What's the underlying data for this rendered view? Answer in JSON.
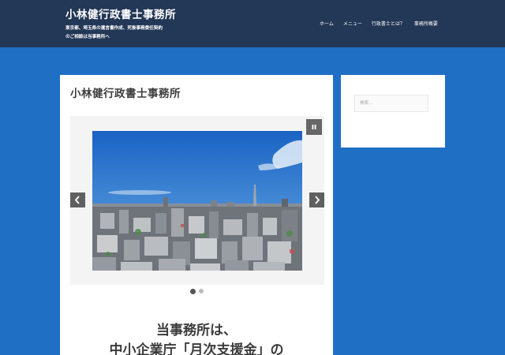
{
  "header": {
    "site_title": "小林健行政書士事務所",
    "description_line1": "東京都、埼玉県の遺言書作成、死後事務委任契約",
    "description_line2": "のご相談は当事務所へ",
    "nav": [
      {
        "label": "ホーム"
      },
      {
        "label": "メニュー"
      },
      {
        "label": "行政書士とは？"
      },
      {
        "label": "事務所概要"
      }
    ]
  },
  "main": {
    "page_title": "小林健行政書士事務所",
    "slider": {
      "prev_icon": "chevron-left-icon",
      "next_icon": "chevron-right-icon",
      "pause_icon": "pause-icon",
      "slide_count": 2,
      "active_slide": 1
    },
    "heading_line1": "当事務所は、",
    "heading_line2": "中小企業庁「月次支援金」の"
  },
  "sidebar": {
    "search_placeholder": "検索..."
  },
  "colors": {
    "background": "#1f6fc5",
    "header": "#233756",
    "panel": "#ffffff",
    "slider_bg": "#f4f4f4",
    "control": "#606060"
  }
}
